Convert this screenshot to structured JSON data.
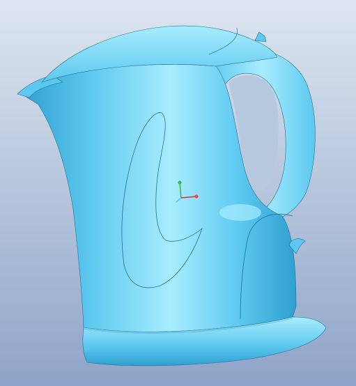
{
  "viewport": {
    "background_top": "#dde6f0",
    "background_bottom": "#8ea4c8"
  },
  "model": {
    "body_color": "#5cc8ef",
    "shadow_color": "#2f9fd0",
    "highlight_color": "#a8ecff",
    "edge_color": "#256f95"
  },
  "triad": {
    "axis_colors": {
      "y": "#2fb84a",
      "x": "#d63030",
      "z": "#38d0ff"
    },
    "origin_color": "#ff4040"
  },
  "icons": [
    "kettle-model",
    "coordinate-triad-icon",
    "lid-button-icon",
    "power-switch-icon"
  ]
}
